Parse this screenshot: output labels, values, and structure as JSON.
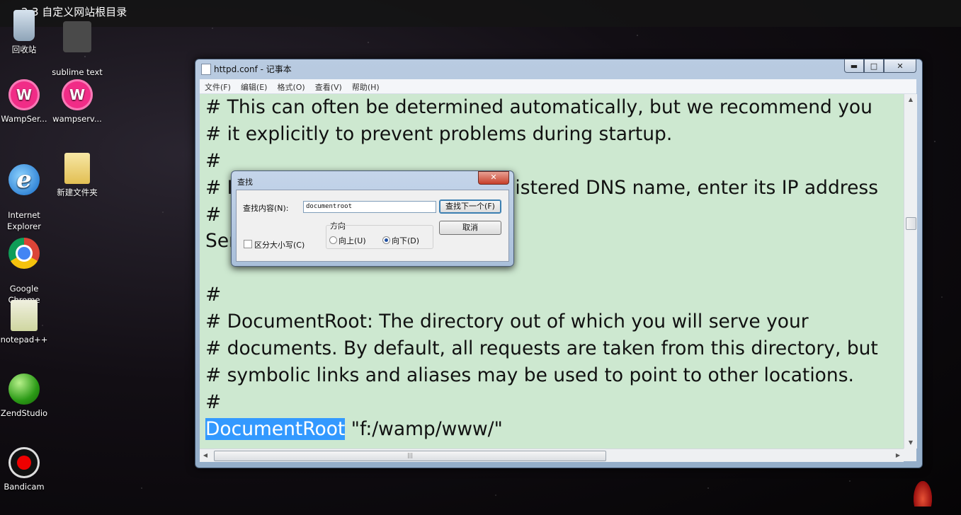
{
  "video": {
    "title": "2-3 自定义网站根目录"
  },
  "desktop": {
    "icons": [
      {
        "label": "回收站"
      },
      {
        "label": "sublime text\n3"
      },
      {
        "label": "WampSer..."
      },
      {
        "label": "wampserv..."
      },
      {
        "label": "Internet\nExplorer"
      },
      {
        "label": "新建文件夹"
      },
      {
        "label": "Google\nChrome"
      },
      {
        "label": "notepad++"
      },
      {
        "label": "ZendStudio"
      },
      {
        "label": "Bandicam"
      }
    ]
  },
  "notepad": {
    "title": "httpd.conf - 记事本",
    "window_buttons": {
      "minimize": "▬",
      "maximize": "□",
      "close": "✕"
    },
    "menu": [
      "文件(F)",
      "编辑(E)",
      "格式(O)",
      "查看(V)",
      "帮助(H)"
    ],
    "lines": [
      "# This can often be determined automatically, but we recommend you",
      "# it explicitly to prevent problems during startup.",
      "#",
      "# If your host doesn't have a registered DNS name, enter its IP address",
      "#",
      "ServerName localhost:80",
      "",
      "#",
      "# DocumentRoot: The directory out of which you will serve your",
      "# documents. By default, all requests are taken from this directory, but",
      "# symbolic links and aliases may be used to point to other locations.",
      "#"
    ],
    "last_line": {
      "highlight": "DocumentRoot",
      "rest": " \"f:/wamp/www/\""
    },
    "scroll_glyphs": {
      "up": "▲",
      "down": "▼",
      "left": "◀",
      "right": "▶",
      "grip": "|||"
    }
  },
  "find_dialog": {
    "title": "查找",
    "close": "✕",
    "find_label": "查找内容(N):",
    "find_value": "documentroot",
    "find_next": "查找下一个(F)",
    "cancel": "取消",
    "direction_label": "方向",
    "up": "向上(U)",
    "down": "向下(D)",
    "match_case": "区分大小写(C)",
    "direction_selected": "down",
    "match_case_checked": false
  },
  "colors": {
    "editor_bg": "#cde8d0",
    "selection": "#3399ff",
    "wamp": "#f12c87"
  }
}
